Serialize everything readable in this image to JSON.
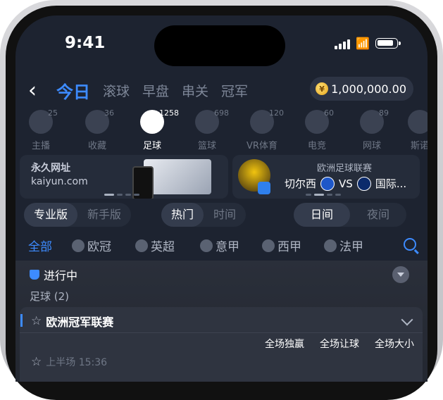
{
  "status": {
    "time": "9:41"
  },
  "nav": {
    "tabs": [
      "今日",
      "滚球",
      "早盘",
      "串关",
      "冠军"
    ],
    "balance": "1,000,000.00"
  },
  "categories": [
    {
      "label": "主播",
      "count": "25",
      "icon": "anchor-icon"
    },
    {
      "label": "收藏",
      "count": "36",
      "icon": "star-icon"
    },
    {
      "label": "足球",
      "count": "1258",
      "icon": "soccer-ball-icon"
    },
    {
      "label": "篮球",
      "count": "698",
      "icon": "basketball-icon"
    },
    {
      "label": "VR体育",
      "count": "120",
      "icon": "vr-icon"
    },
    {
      "label": "电竞",
      "count": "60",
      "icon": "gamepad-icon"
    },
    {
      "label": "网球",
      "count": "89",
      "icon": "tennis-icon"
    },
    {
      "label": "斯诺",
      "count": "",
      "icon": "snooker-icon"
    }
  ],
  "banner_left": {
    "title": "永久网址",
    "url": "kaiyun.com"
  },
  "banner_right": {
    "league": "欧洲足球联赛",
    "home": "切尔西",
    "vs": "VS",
    "away": "国际..."
  },
  "filters": {
    "mode": [
      "专业版",
      "新手版"
    ],
    "sort": [
      "热门",
      "时间"
    ],
    "time": [
      "日间",
      "夜间"
    ]
  },
  "league_tabs": [
    "全部",
    "欧冠",
    "英超",
    "意甲",
    "西甲",
    "法甲"
  ],
  "live": {
    "heading": "进行中",
    "sport_count": "足球 (2)",
    "league": "欧洲冠军联赛",
    "markets": [
      "全场独赢",
      "全场让球",
      "全场大小"
    ],
    "match_time": "上半场 15:36"
  }
}
